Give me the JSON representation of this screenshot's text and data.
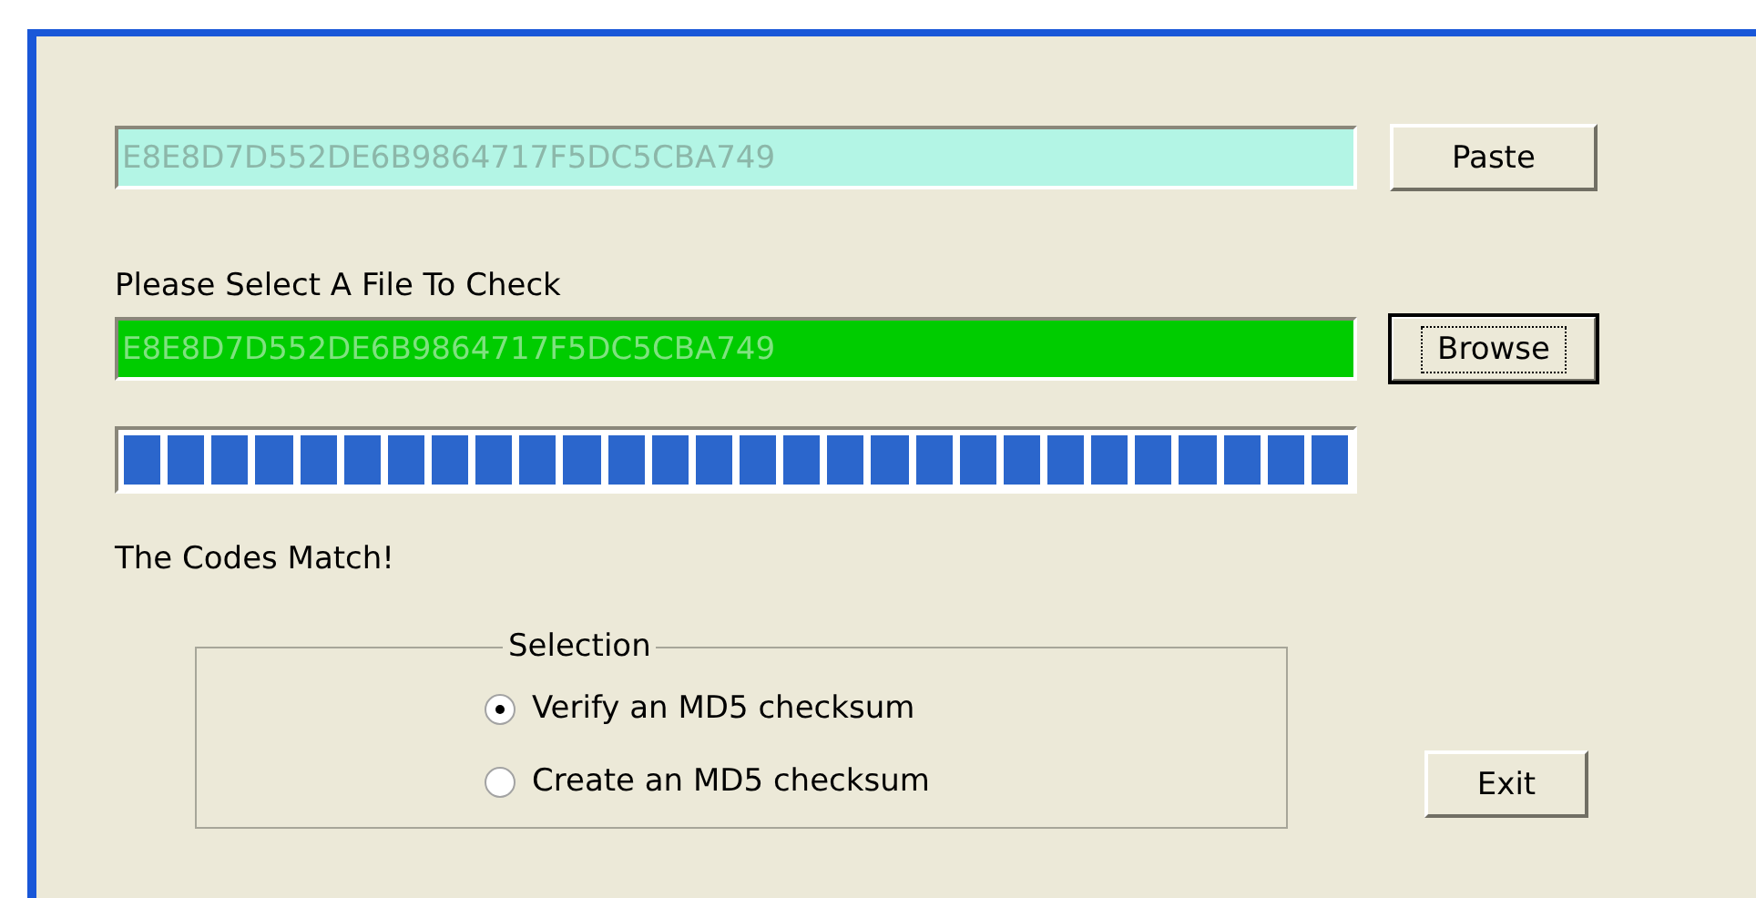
{
  "hash_field": {
    "value": "E8E8D7D552DE6B9864717F5DC5CBA749"
  },
  "paste_button": {
    "label": "Paste"
  },
  "file_label": "Please Select A File To Check",
  "file_field": {
    "value": "E8E8D7D552DE6B9864717F5DC5CBA749",
    "matched": true
  },
  "browse_button": {
    "label": "Browse",
    "focused": true
  },
  "progress": {
    "level": 1
  },
  "status": "The Codes Match!",
  "selection": {
    "title": "Selection",
    "options": [
      {
        "label": "Verify an MD5 checksum",
        "selected": true
      },
      {
        "label": "Create an MD5 checksum",
        "selected": false
      }
    ]
  },
  "exit_button": {
    "label": "Exit"
  }
}
